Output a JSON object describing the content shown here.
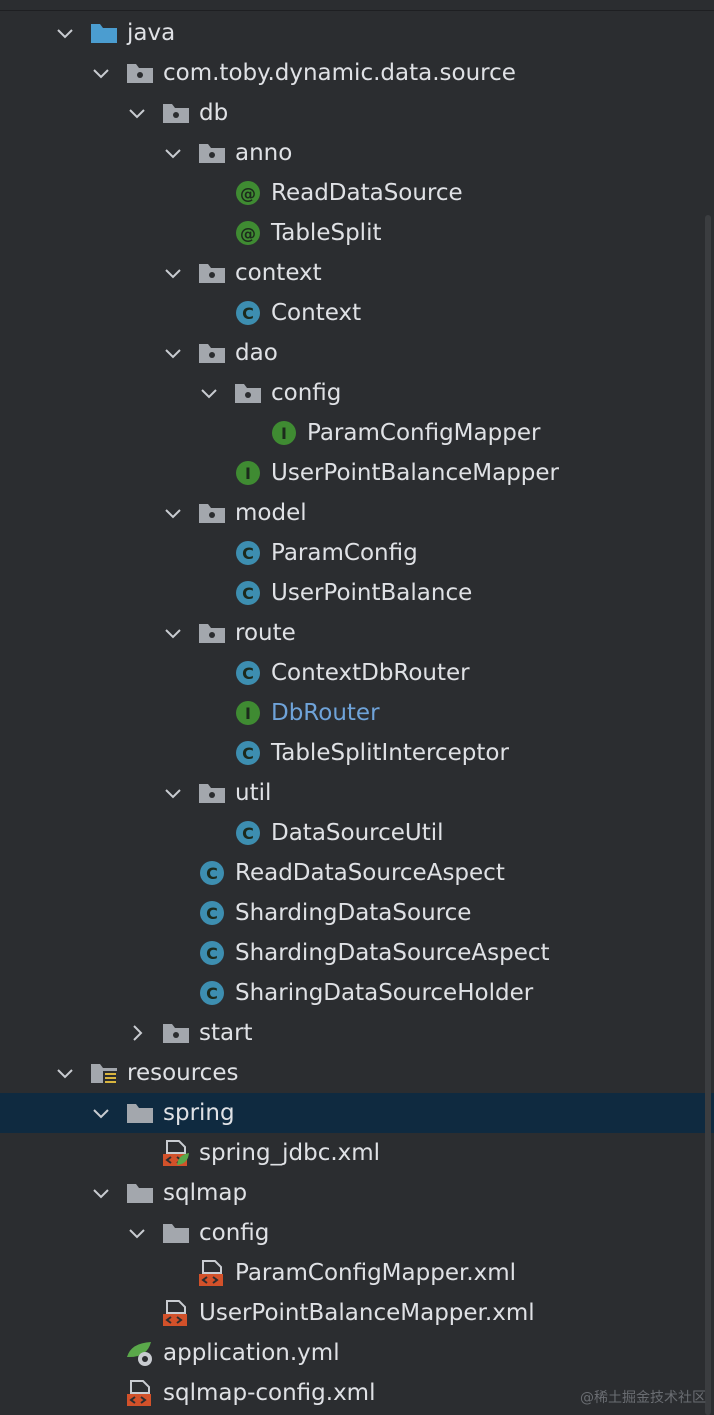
{
  "tree": [
    {
      "depth": 0,
      "kind": "src-folder",
      "expanded": true,
      "label": "java"
    },
    {
      "depth": 1,
      "kind": "package",
      "expanded": true,
      "label": "com.toby.dynamic.data.source"
    },
    {
      "depth": 2,
      "kind": "package",
      "expanded": true,
      "label": "db"
    },
    {
      "depth": 3,
      "kind": "package",
      "expanded": true,
      "label": "anno"
    },
    {
      "depth": 4,
      "kind": "annotation",
      "label": "ReadDataSource"
    },
    {
      "depth": 4,
      "kind": "annotation",
      "label": "TableSplit"
    },
    {
      "depth": 3,
      "kind": "package",
      "expanded": true,
      "label": "context"
    },
    {
      "depth": 4,
      "kind": "class",
      "label": "Context"
    },
    {
      "depth": 3,
      "kind": "package",
      "expanded": true,
      "label": "dao"
    },
    {
      "depth": 4,
      "kind": "package",
      "expanded": true,
      "label": "config"
    },
    {
      "depth": 5,
      "kind": "interface",
      "label": "ParamConfigMapper"
    },
    {
      "depth": 4,
      "kind": "interface",
      "label": "UserPointBalanceMapper"
    },
    {
      "depth": 3,
      "kind": "package",
      "expanded": true,
      "label": "model"
    },
    {
      "depth": 4,
      "kind": "class",
      "label": "ParamConfig"
    },
    {
      "depth": 4,
      "kind": "class",
      "label": "UserPointBalance"
    },
    {
      "depth": 3,
      "kind": "package",
      "expanded": true,
      "label": "route"
    },
    {
      "depth": 4,
      "kind": "class",
      "label": "ContextDbRouter"
    },
    {
      "depth": 4,
      "kind": "interface",
      "label": "DbRouter",
      "link": true
    },
    {
      "depth": 4,
      "kind": "class",
      "label": "TableSplitInterceptor"
    },
    {
      "depth": 3,
      "kind": "package",
      "expanded": true,
      "label": "util"
    },
    {
      "depth": 4,
      "kind": "class",
      "label": "DataSourceUtil"
    },
    {
      "depth": 3,
      "kind": "class",
      "label": "ReadDataSourceAspect"
    },
    {
      "depth": 3,
      "kind": "class",
      "label": "ShardingDataSource"
    },
    {
      "depth": 3,
      "kind": "class",
      "label": "ShardingDataSourceAspect"
    },
    {
      "depth": 3,
      "kind": "class",
      "label": "SharingDataSourceHolder"
    },
    {
      "depth": 2,
      "kind": "package",
      "expanded": false,
      "label": "start"
    },
    {
      "depth": 0,
      "kind": "resources-folder",
      "expanded": true,
      "label": "resources"
    },
    {
      "depth": 1,
      "kind": "folder",
      "expanded": true,
      "label": "spring",
      "selected": true
    },
    {
      "depth": 2,
      "kind": "spring-xml",
      "label": "spring_jdbc.xml"
    },
    {
      "depth": 1,
      "kind": "folder",
      "expanded": true,
      "label": "sqlmap"
    },
    {
      "depth": 2,
      "kind": "folder",
      "expanded": true,
      "label": "config"
    },
    {
      "depth": 3,
      "kind": "xml",
      "label": "ParamConfigMapper.xml"
    },
    {
      "depth": 2,
      "kind": "xml",
      "label": "UserPointBalanceMapper.xml"
    },
    {
      "depth": 1,
      "kind": "yml",
      "label": "application.yml"
    },
    {
      "depth": 1,
      "kind": "xml",
      "label": "sqlmap-config.xml"
    }
  ],
  "colors": {
    "background": "#2b2d30",
    "selection": "#0f2a40",
    "text": "#dfe1e5",
    "link_text": "#6fa3d9",
    "class_icon": "#3d8eb0",
    "annotation_icon": "#3f8b32",
    "interface_icon": "#3f8b32",
    "folder_icon": "#a3a7ad",
    "src_folder_icon": "#4b9dd0",
    "xml_icon": "#d2512a"
  },
  "watermark": "@稀土掘金技术社区"
}
